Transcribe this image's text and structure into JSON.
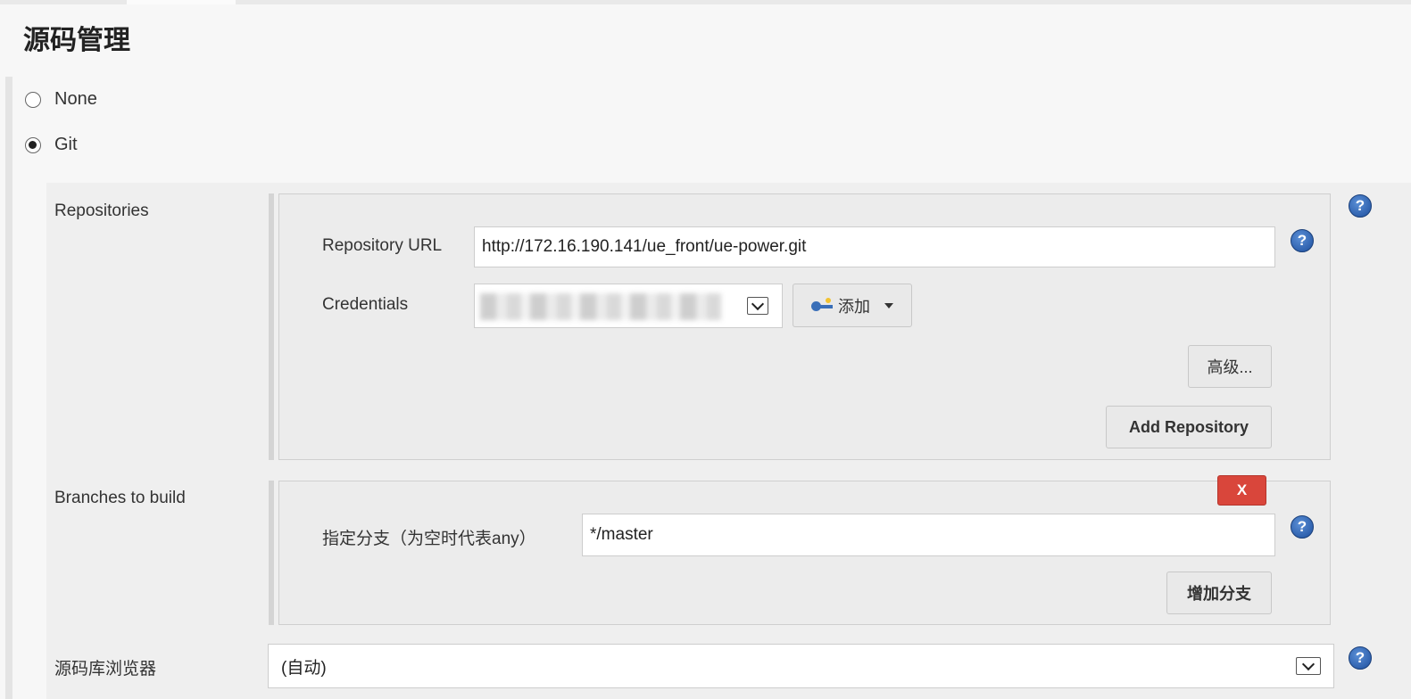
{
  "section": {
    "title": "源码管理"
  },
  "scm_options": [
    {
      "label": "None",
      "selected": false
    },
    {
      "label": "Git",
      "selected": true
    }
  ],
  "repositories": {
    "label": "Repositories",
    "repository_url_label": "Repository URL",
    "repository_url_value": "http://172.16.190.141/ue_front/ue-power.git",
    "credentials_label": "Credentials",
    "add_button_label": "添加",
    "advanced_button_label": "高级...",
    "add_repository_button_label": "Add Repository"
  },
  "branches": {
    "label": "Branches to build",
    "delete_button_label": "X",
    "branch_spec_label": "指定分支（为空时代表any）",
    "branch_spec_value": "*/master",
    "add_branch_button_label": "增加分支"
  },
  "repo_browser": {
    "label": "源码库浏览器",
    "selected_value": "(自动)"
  },
  "icons": {
    "help": "help-icon",
    "credentials_add": "key-icon",
    "dropdown": "chevron-down-icon"
  },
  "colors": {
    "help_icon": "#1d4f9e",
    "delete_button": "#d9463b"
  }
}
